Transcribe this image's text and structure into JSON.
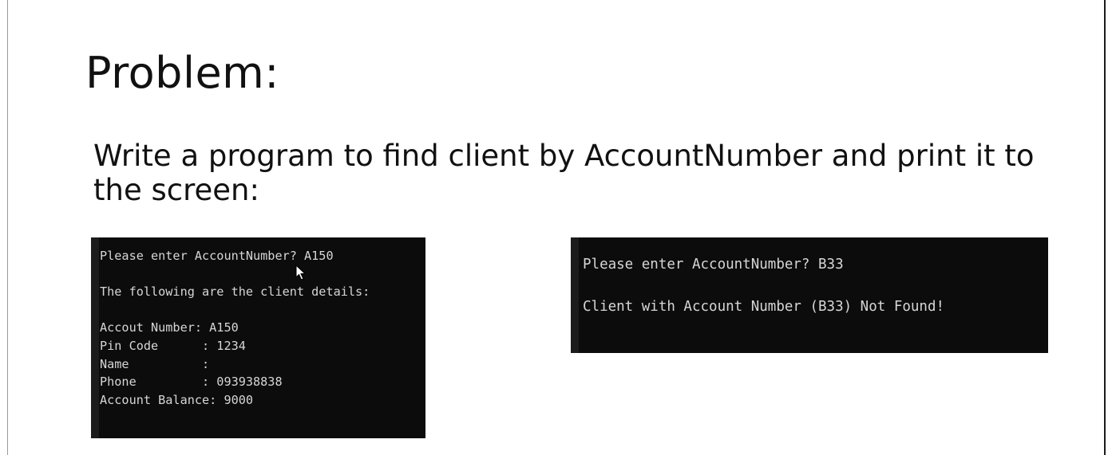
{
  "slide": {
    "title": "Problem:",
    "problem_text": "Write a program to find client by AccountNumber and print it to the screen:"
  },
  "console_found": {
    "lines": [
      "Please enter AccountNumber? A150",
      "",
      "The following are the client details:",
      "",
      "Accout Number: A150",
      "Pin Code      : 1234",
      "Name          :",
      "Phone         : 093938838",
      "Account Balance: 9000"
    ]
  },
  "console_not_found": {
    "lines": [
      "Please enter AccountNumber? B33",
      "",
      "Client with Account Number (B33) Not Found!"
    ]
  },
  "icons": {
    "mouse_cursor": "arrow-pointer"
  },
  "colors": {
    "console_background": "#0c0c0c",
    "console_text": "#d6d6d6",
    "slide_background": "#ffffff",
    "slide_text": "#111111"
  }
}
